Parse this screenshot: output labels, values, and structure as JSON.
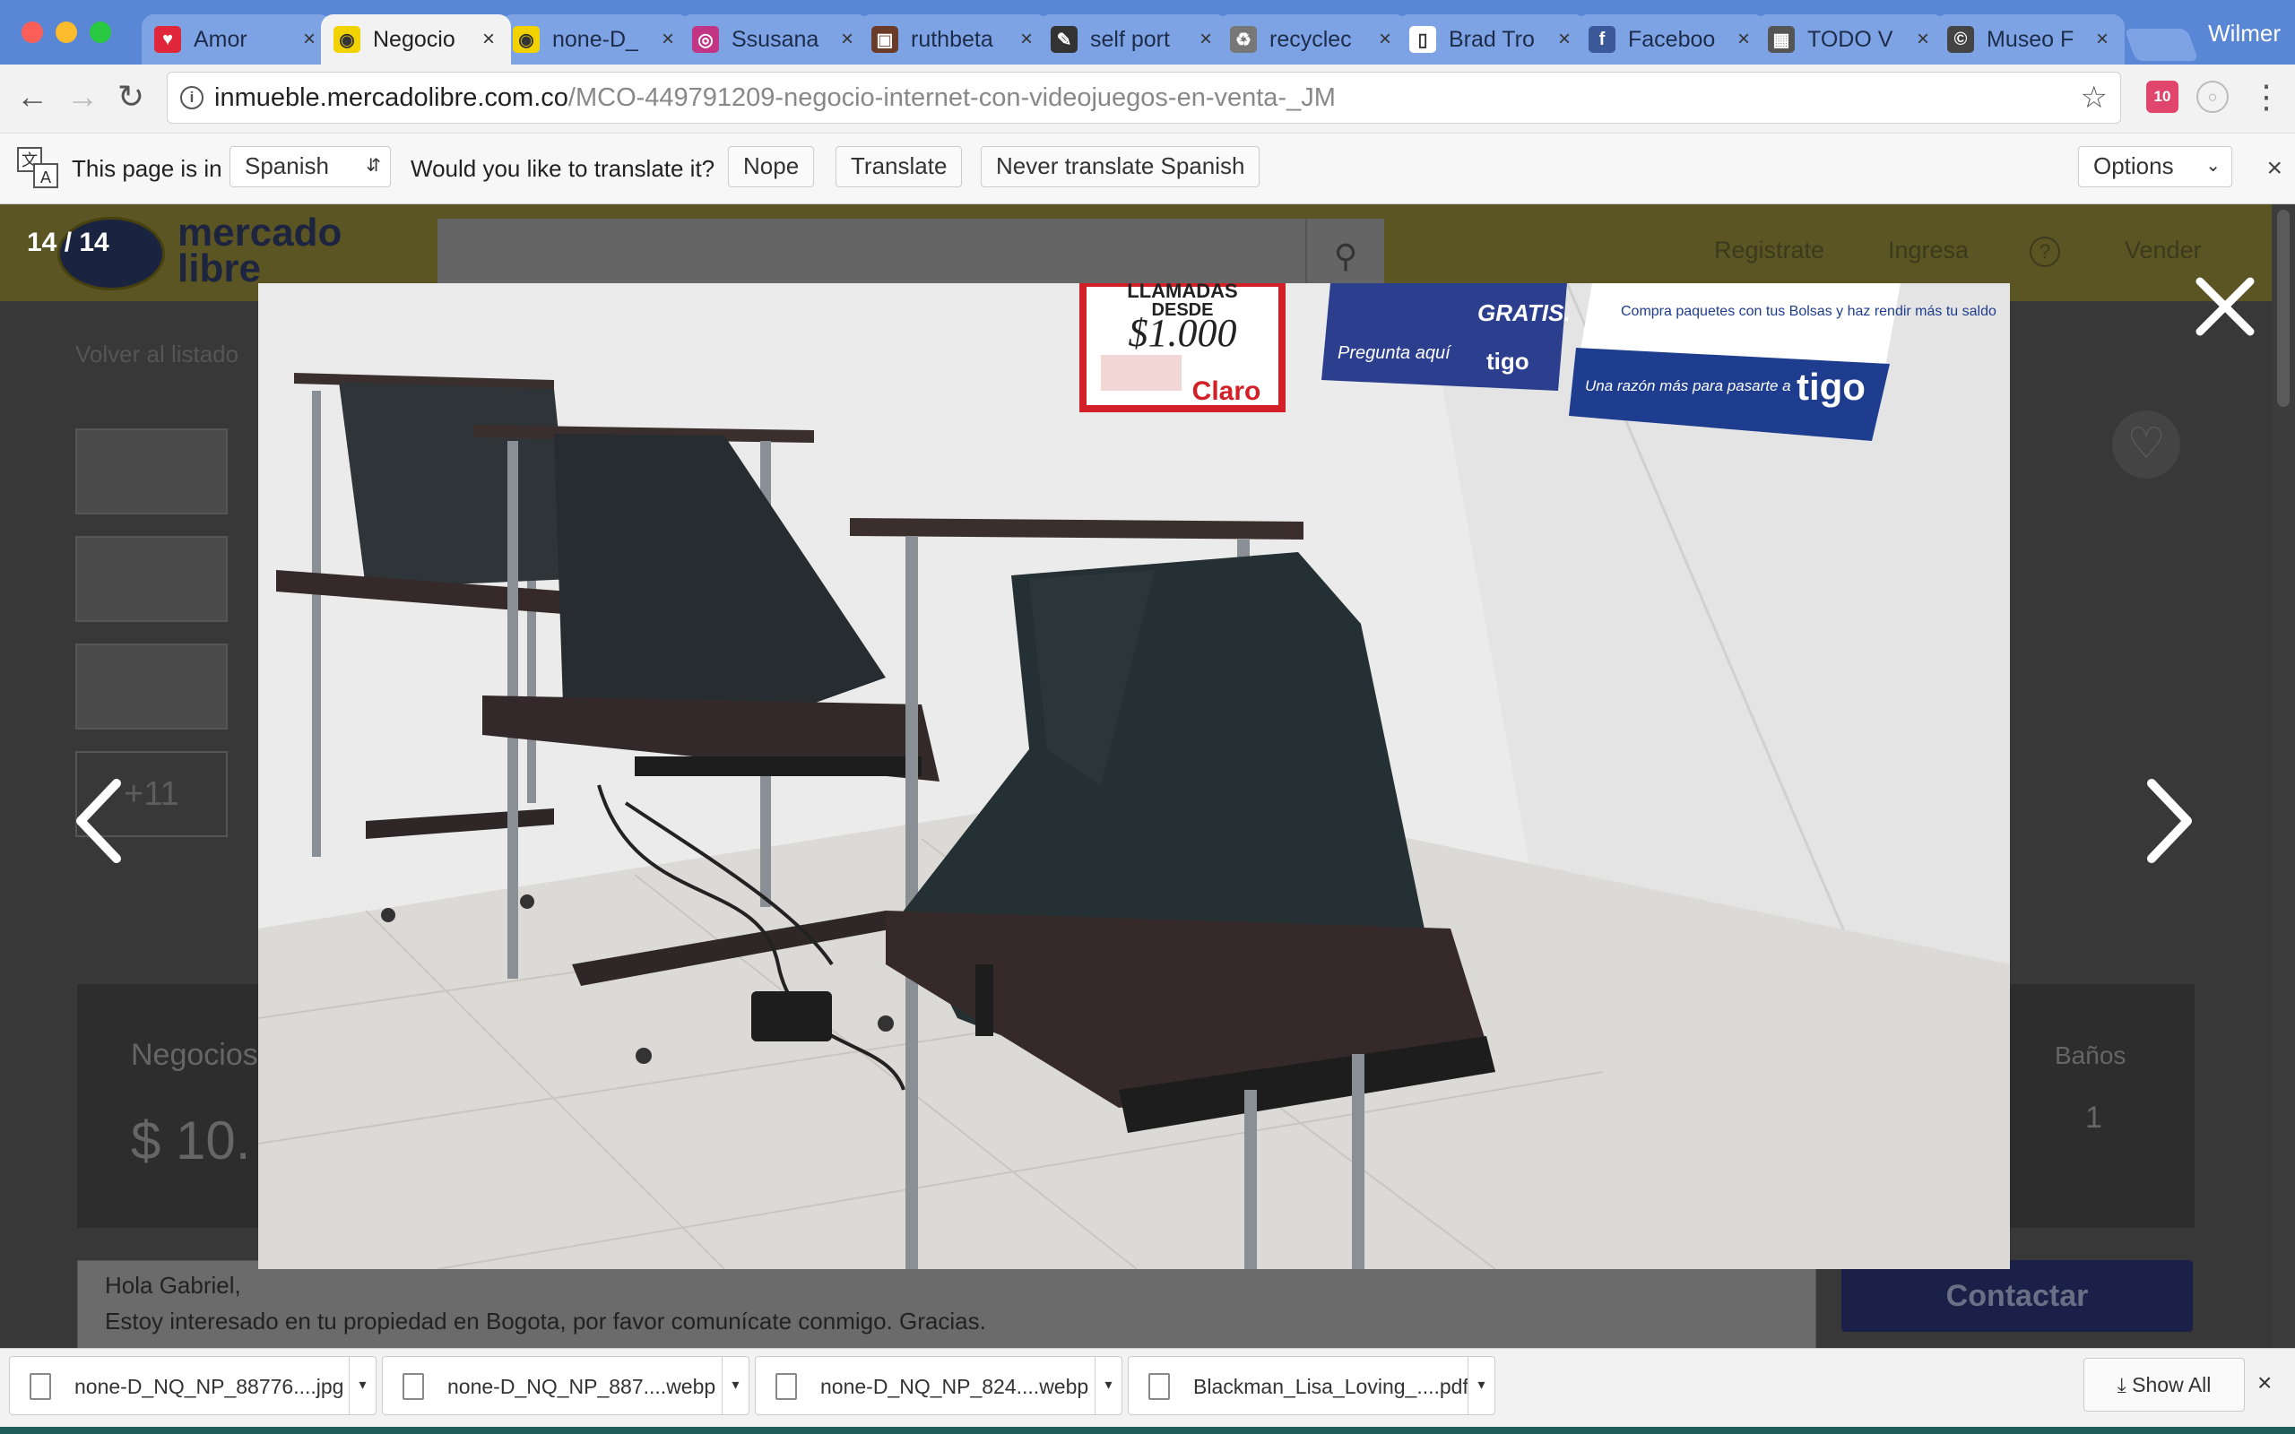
{
  "browser": {
    "tabs": [
      {
        "title": "Amor",
        "icon": "heart-icon",
        "color": "#e0263a"
      },
      {
        "title": "Negocio",
        "icon": "mercadolibre-icon",
        "color": "#f2d300",
        "active": true
      },
      {
        "title": "none-D_",
        "icon": "mercadolibre-icon",
        "color": "#f2d300"
      },
      {
        "title": "Ssusana",
        "icon": "instagram-icon",
        "color": "#c13584"
      },
      {
        "title": "ruthbeta",
        "icon": "photo-icon",
        "color": "#6b3b2a"
      },
      {
        "title": "self port",
        "icon": "art-icon",
        "color": "#333333"
      },
      {
        "title": "recyclec",
        "icon": "recycle-icon",
        "color": "#777777"
      },
      {
        "title": "Brad Tro",
        "icon": "document-icon",
        "color": "#ffffff"
      },
      {
        "title": "Faceboo",
        "icon": "facebook-icon",
        "color": "#3b5998"
      },
      {
        "title": "TODO V",
        "icon": "grid-icon",
        "color": "#555555"
      },
      {
        "title": "Museo F",
        "icon": "copyright-icon",
        "color": "#444444"
      }
    ],
    "tab_close": "×",
    "profile_name": "Wilmer",
    "url_host": "inmueble.mercadolibre.com.co",
    "url_path": "/MCO-449791209-negocio-internet-con-videojuegos-en-venta-_JM",
    "extension_badge": "10"
  },
  "translate_bar": {
    "prefix": "This page is in",
    "language": "Spanish",
    "question": "Would you like to translate it?",
    "nope": "Nope",
    "translate": "Translate",
    "never": "Never translate Spanish",
    "options": "Options",
    "close": "×"
  },
  "page": {
    "logo_text": "mercado libre",
    "nav": {
      "register": "Registrate",
      "login": "Ingresa",
      "help": "?",
      "sell": "Vender"
    },
    "back_to_list": "Volver al listado",
    "more_photos": "+11",
    "category": "Negocios",
    "price_partial": "$ 10.",
    "bathrooms_label": "Baños",
    "bathrooms_value": "1",
    "message_line1": "Hola Gabriel,",
    "message_line2": "Estoy interesado en tu propiedad en Bogota, por favor comunícate conmigo. Gracias.",
    "contact_button": "Contactar"
  },
  "lightbox": {
    "counter": "14 / 14",
    "poster_claro_line1": "LLAMADAS",
    "poster_claro_line2": "DESDE",
    "poster_claro_price": "$1.000",
    "poster_claro_brand": "Claro",
    "poster_blue_text1": "GRATIS.",
    "poster_blue_text2": "Pregunta aquí",
    "poster_tigo_text": "Compra paquetes con tus Bolsas y haz rendir más tu saldo",
    "poster_tigo_slogan": "Una razón más para pasarte a",
    "tigo_brand": "tigo"
  },
  "downloads": {
    "items": [
      {
        "name": "none-D_NQ_NP_88776....jpg"
      },
      {
        "name": "none-D_NQ_NP_887....webp"
      },
      {
        "name": "none-D_NQ_NP_824....webp"
      },
      {
        "name": "Blackman_Lisa_Loving_....pdf"
      }
    ],
    "show_all": "Show All",
    "close": "×"
  },
  "colors": {
    "tabstrip": "#5a86d6",
    "ml_header_dimmed": "#5b5423",
    "claro_red": "#d31f27",
    "tigo_blue": "#1f3d8f"
  }
}
